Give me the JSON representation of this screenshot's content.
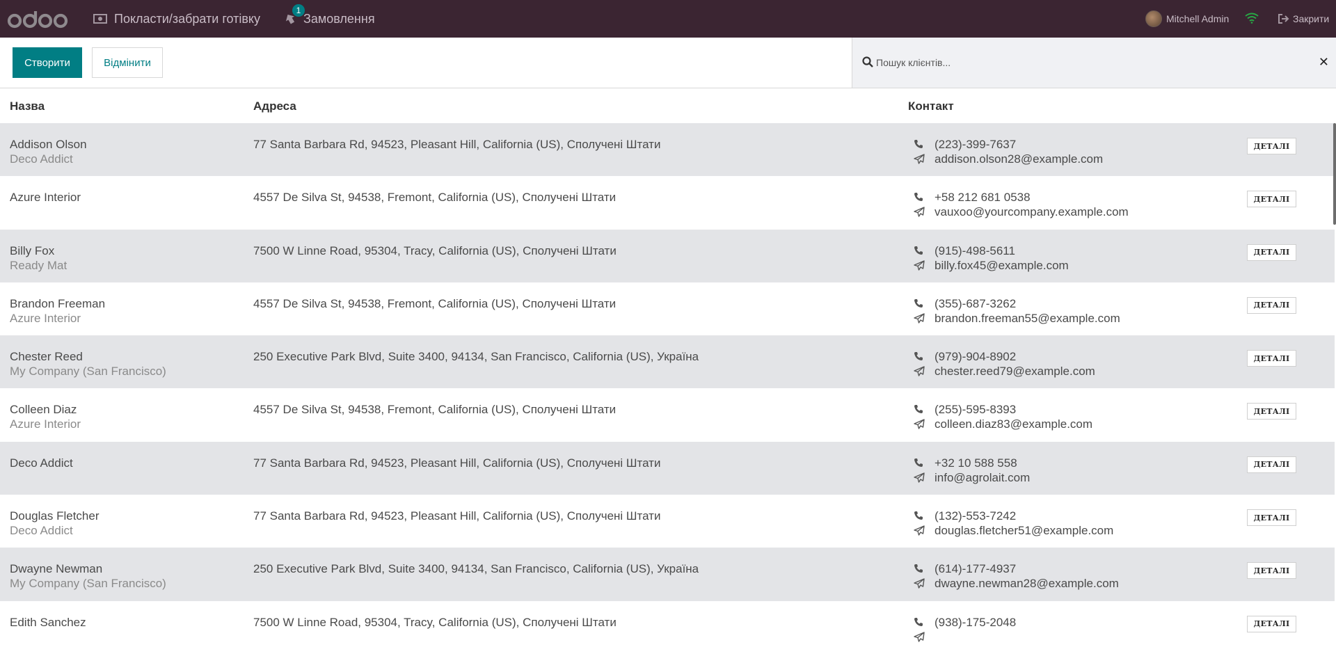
{
  "navbar": {
    "logo_text": "odoo",
    "cash_label": "Покласти/забрати готівку",
    "orders_label": "Замовлення",
    "orders_badge": "1",
    "user_name": "Mitchell Admin",
    "close_label": "Закрити"
  },
  "control": {
    "create_label": "Створити",
    "cancel_label": "Відмінити",
    "search_placeholder": "Пошук клієнтів...",
    "clear_label": "✕"
  },
  "table": {
    "headers": {
      "name": "Назва",
      "address": "Адреса",
      "contact": "Контакт"
    },
    "details_label": "ДЕТАЛІ",
    "rows": [
      {
        "name": "Addison Olson",
        "company": "Deco Addict",
        "address": "77 Santa Barbara Rd, 94523, Pleasant Hill, California (US), Сполучені Штати",
        "phone": "(223)-399-7637",
        "email": "addison.olson28@example.com"
      },
      {
        "name": "Azure Interior",
        "company": "",
        "address": "4557 De Silva St, 94538, Fremont, California (US), Сполучені Штати",
        "phone": "+58 212 681 0538",
        "email": "vauxoo@yourcompany.example.com"
      },
      {
        "name": "Billy Fox",
        "company": "Ready Mat",
        "address": "7500 W Linne Road, 95304, Tracy, California (US), Сполучені Штати",
        "phone": "(915)-498-5611",
        "email": "billy.fox45@example.com"
      },
      {
        "name": "Brandon Freeman",
        "company": "Azure Interior",
        "address": "4557 De Silva St, 94538, Fremont, California (US), Сполучені Штати",
        "phone": "(355)-687-3262",
        "email": "brandon.freeman55@example.com"
      },
      {
        "name": "Chester Reed",
        "company": "My Company (San Francisco)",
        "address": "250 Executive Park Blvd, Suite 3400, 94134, San Francisco, California (US), Україна",
        "phone": "(979)-904-8902",
        "email": "chester.reed79@example.com"
      },
      {
        "name": "Colleen Diaz",
        "company": "Azure Interior",
        "address": "4557 De Silva St, 94538, Fremont, California (US), Сполучені Штати",
        "phone": "(255)-595-8393",
        "email": "colleen.diaz83@example.com"
      },
      {
        "name": "Deco Addict",
        "company": "",
        "address": "77 Santa Barbara Rd, 94523, Pleasant Hill, California (US), Сполучені Штати",
        "phone": "+32 10 588 558",
        "email": "info@agrolait.com"
      },
      {
        "name": "Douglas Fletcher",
        "company": "Deco Addict",
        "address": "77 Santa Barbara Rd, 94523, Pleasant Hill, California (US), Сполучені Штати",
        "phone": "(132)-553-7242",
        "email": "douglas.fletcher51@example.com"
      },
      {
        "name": "Dwayne Newman",
        "company": "My Company (San Francisco)",
        "address": "250 Executive Park Blvd, Suite 3400, 94134, San Francisco, California (US), Україна",
        "phone": "(614)-177-4937",
        "email": "dwayne.newman28@example.com"
      },
      {
        "name": "Edith Sanchez",
        "company": "",
        "address": "7500 W Linne Road, 95304, Tracy, California (US), Сполучені Штати",
        "phone": "(938)-175-2048",
        "email": ""
      }
    ]
  },
  "colors": {
    "navbar_bg": "#3b2532",
    "accent": "#017e84",
    "row_alt": "#e3e4e7"
  },
  "icons": {
    "cash": "money-icon",
    "orders": "ticket-icon",
    "wifi": "wifi-icon",
    "close": "sign-out-icon",
    "search": "search-icon",
    "phone": "phone-icon",
    "email": "paper-plane-icon"
  }
}
